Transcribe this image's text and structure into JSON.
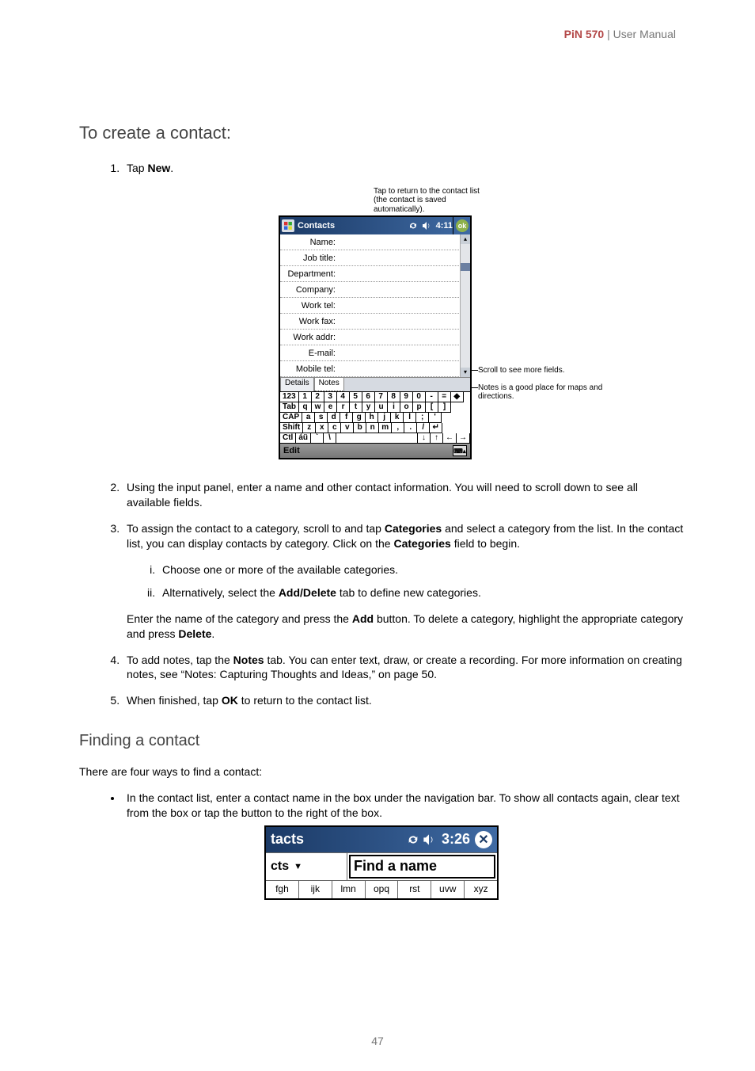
{
  "header": {
    "brand": "PiN 570",
    "divider": " | ",
    "title": "User Manual"
  },
  "sections": {
    "create_heading": "To create a contact:",
    "find_heading": "Finding a contact",
    "find_intro": "There are four ways to find a contact:"
  },
  "steps": {
    "s1a": "Tap ",
    "s1b": "New",
    "s1c": ".",
    "s2": "Using the input panel, enter a name and other contact information. You will need to scroll down to see all available fields.",
    "s3a": "To assign the contact to a category, scroll to and tap ",
    "s3b": "Categories",
    "s3c": " and select a category from the list. In the contact list, you can display contacts by category.  Click on the ",
    "s3d": "Categories",
    "s3e": " field to begin.",
    "s3i": "Choose one or more of the available categories.",
    "s3ii_a": "Alternatively, select the ",
    "s3ii_b": "Add/Delete",
    "s3ii_c": " tab to define new categories.",
    "s3f_a": "Enter the name of the category and press the ",
    "s3f_b": "Add",
    "s3f_c": " button.  To delete a category, highlight the appropriate category and press ",
    "s3f_d": "Delete",
    "s3f_e": ".",
    "s4a": "To add notes, tap the ",
    "s4b": "Notes",
    "s4c": " tab. You can enter text, draw, or create a recording. For more information on creating notes, see “Notes: Capturing Thoughts and Ideas,” on page 50.",
    "s5a": "When finished, tap ",
    "s5b": "OK",
    "s5c": " to return to the contact list."
  },
  "bullet1": "In the contact list, enter a contact name in the box under the navigation bar. To show all contacts again, clear text from the box or tap the button to the right of the box.",
  "shot1": {
    "callout_top": "Tap to return to the contact list (the contact is saved automatically).",
    "title": "Contacts",
    "time": "4:11",
    "ok": "ok",
    "fields": [
      "Name:",
      "Job title:",
      "Department:",
      "Company:",
      "Work tel:",
      "Work fax:",
      "Work addr:",
      "E-mail:",
      "Mobile tel:"
    ],
    "tab_details": "Details",
    "tab_notes": "Notes",
    "kbd_rows": [
      [
        "123",
        "1",
        "2",
        "3",
        "4",
        "5",
        "6",
        "7",
        "8",
        "9",
        "0",
        "-",
        "=",
        "◆"
      ],
      [
        "Tab",
        "q",
        "w",
        "e",
        "r",
        "t",
        "y",
        "u",
        "i",
        "o",
        "p",
        "[",
        "]"
      ],
      [
        "CAP",
        "a",
        "s",
        "d",
        "f",
        "g",
        "h",
        "j",
        "k",
        "l",
        ";",
        "'"
      ],
      [
        "Shift",
        "z",
        "x",
        "c",
        "v",
        "b",
        "n",
        "m",
        ",",
        ".",
        "/",
        "↵"
      ],
      [
        "Ctl",
        "áü",
        "`",
        "\\",
        "",
        "↓",
        "↑",
        "←",
        "→"
      ]
    ],
    "edit": "Edit",
    "callout_r1": "Scroll to see more fields.",
    "callout_r2": "Notes is a good place for maps and directions."
  },
  "shot2": {
    "title_fragment": "tacts",
    "time": "3:26",
    "left_fragment": "cts",
    "find": "Find a name",
    "alpha": [
      "fgh",
      "ijk",
      "lmn",
      "opq",
      "rst",
      "uvw",
      "xyz"
    ]
  },
  "page_number": "47",
  "icons": {
    "speaker": "speaker-icon",
    "sync": "sync-icon",
    "close": "close-icon",
    "dropdown": "dropdown-icon"
  }
}
